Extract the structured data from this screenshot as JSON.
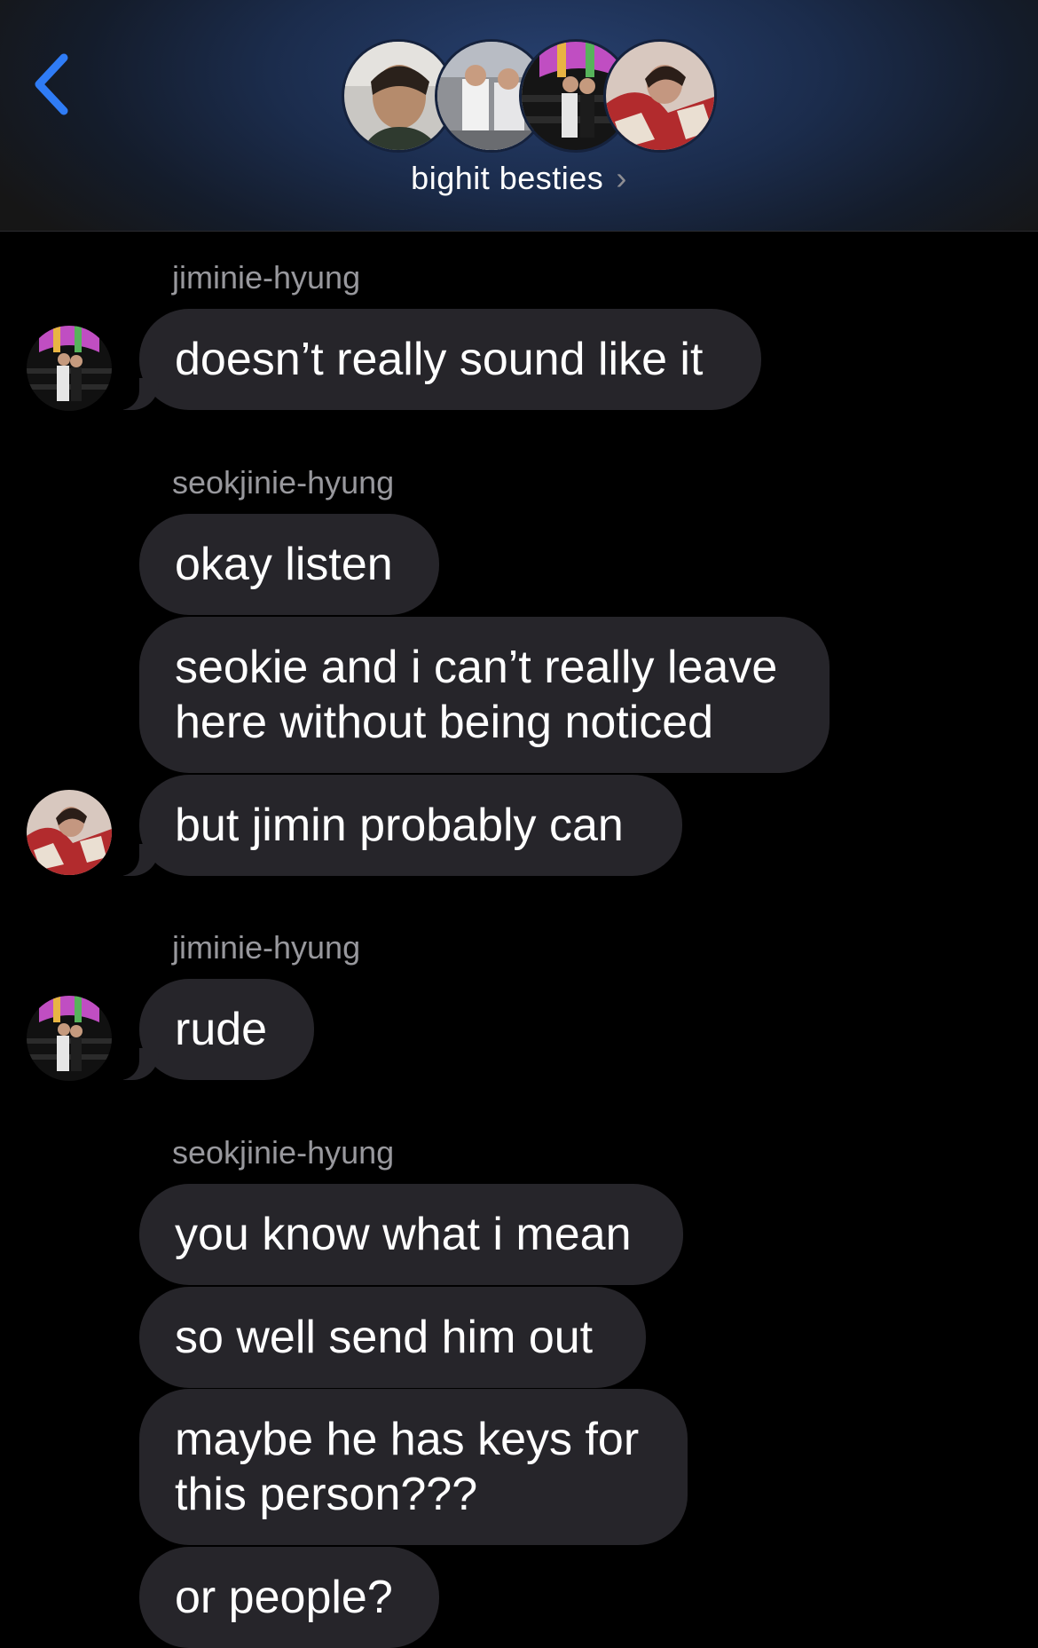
{
  "header": {
    "group_name": "bighit besties",
    "chevron": "›",
    "back_icon": "chevron-left-icon",
    "accent_color": "#2f7cf6"
  },
  "messages": [
    {
      "sender": "jiminie-hyung",
      "texts": [
        "doesn’t really sound like it"
      ]
    },
    {
      "sender": "seokjinie-hyung",
      "texts": [
        "okay listen",
        "seokie and i can’t really leave here without being noticed",
        "but jimin probably can"
      ]
    },
    {
      "sender": "jiminie-hyung",
      "texts": [
        "rude"
      ]
    },
    {
      "sender": "seokjinie-hyung",
      "texts": [
        "you know what i mean",
        "so well send him out",
        "maybe he has keys for this person???",
        "or people?"
      ]
    }
  ],
  "theme": {
    "background": "#000000",
    "bubble_color": "#26252a",
    "sender_color": "#98989d"
  }
}
